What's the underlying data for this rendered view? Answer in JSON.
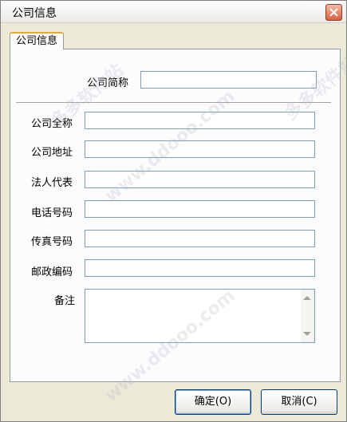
{
  "window": {
    "title": "公司信息"
  },
  "tab": {
    "label": "公司信息"
  },
  "form": {
    "short_name_label": "公司简称",
    "short_name_value": "",
    "full_name_label": "公司全称",
    "full_name_value": "",
    "address_label": "公司地址",
    "address_value": "",
    "legal_rep_label": "法人代表",
    "legal_rep_value": "",
    "phone_label": "电话号码",
    "phone_value": "",
    "fax_label": "传真号码",
    "fax_value": "",
    "postcode_label": "邮政编码",
    "postcode_value": "",
    "notes_label": "备注",
    "notes_value": ""
  },
  "buttons": {
    "ok_label": "确定(O)",
    "cancel_label": "取消(C)"
  },
  "watermark": {
    "text_cn": "多多软件站",
    "text_url": "www.ddooo.com"
  },
  "colors": {
    "close_button": "#d9603d",
    "tab_accent": "#f5a623",
    "field_border": "#7f9db9",
    "button_border": "#003c74"
  }
}
